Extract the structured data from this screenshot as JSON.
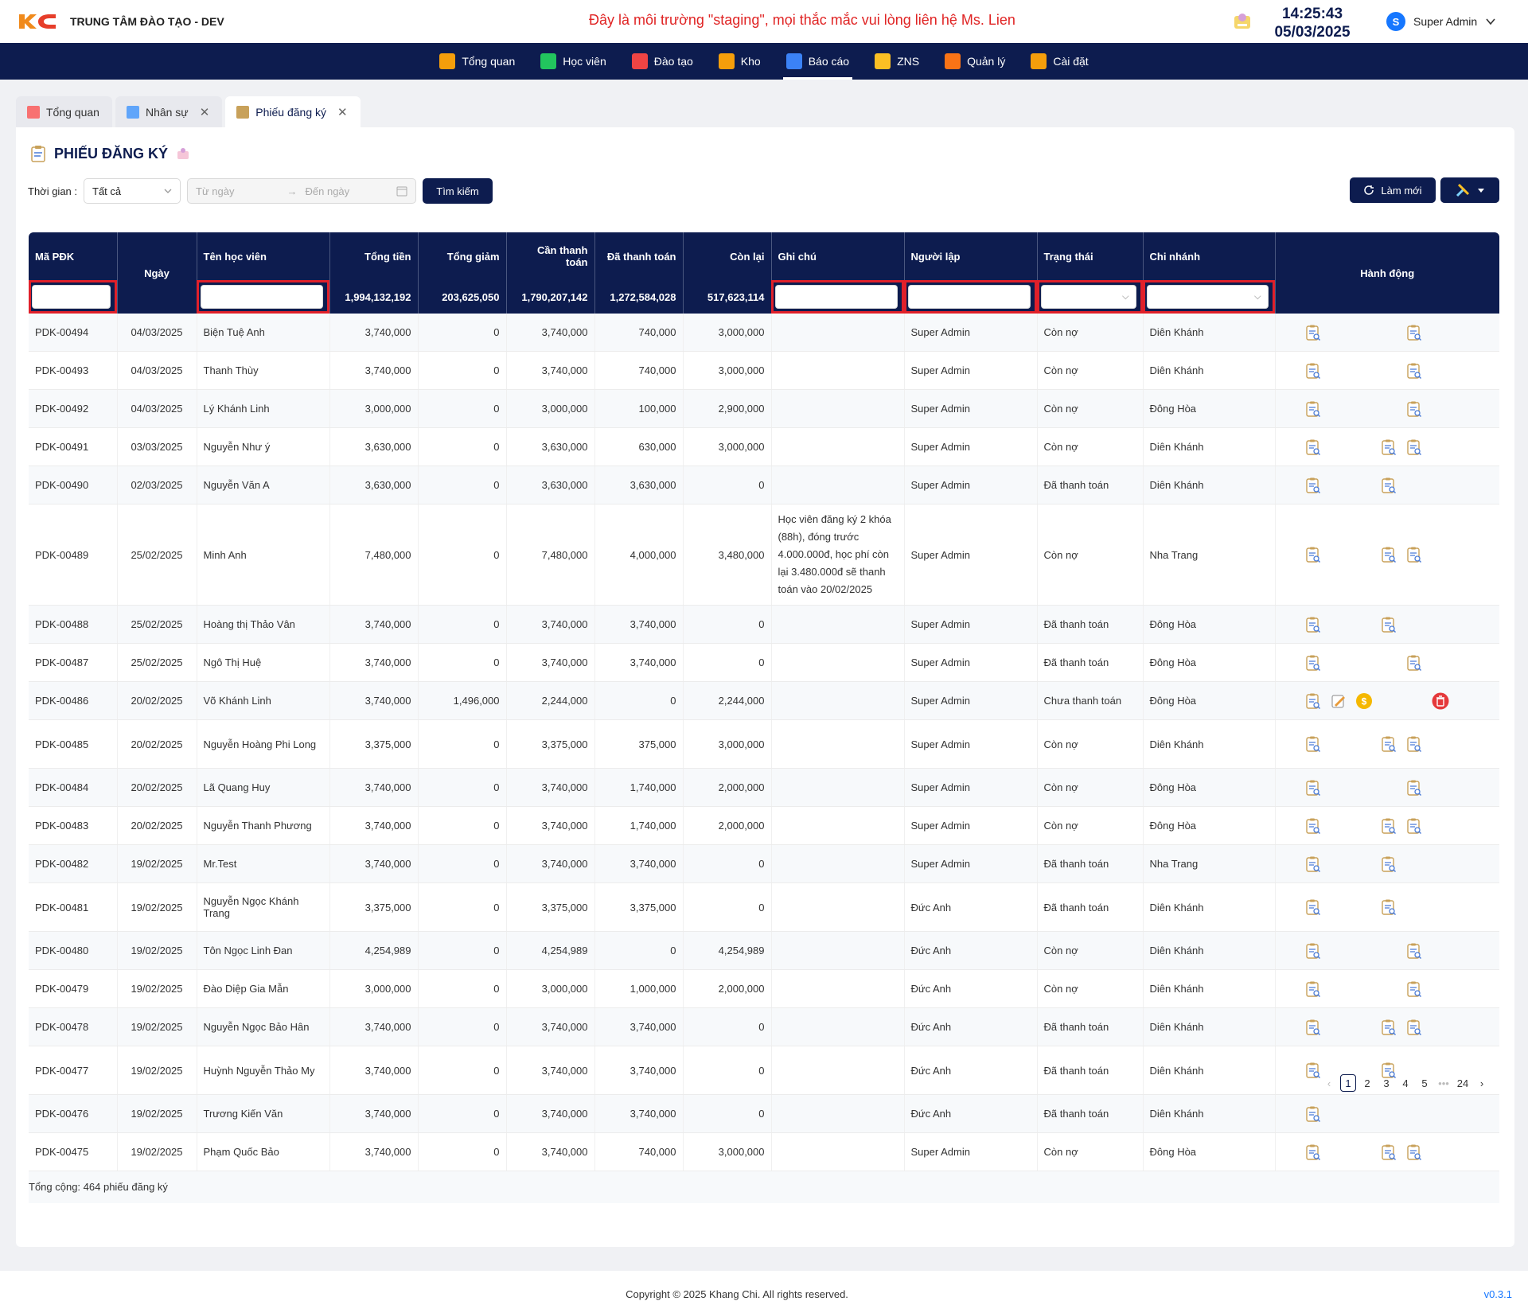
{
  "header": {
    "brand": "TRUNG TÂM ĐÀO TẠO - DEV",
    "marquee": "Đây là môi trường \"staging\", mọi thắc mắc vui lòng liên hệ Ms. Lien",
    "time": "14:25:43",
    "date": "05/03/2025",
    "avatar_letter": "S",
    "user": "Super Admin"
  },
  "nav": [
    {
      "label": "Tổng quan",
      "icon": "grid-icon",
      "color": "#f59e0b"
    },
    {
      "label": "Học viên",
      "icon": "graduation-cap-icon",
      "color": "#22c55e"
    },
    {
      "label": "Đào tạo",
      "icon": "pen-icon",
      "color": "#ef4444"
    },
    {
      "label": "Kho",
      "icon": "box-icon",
      "color": "#f59e0b"
    },
    {
      "label": "Báo cáo",
      "icon": "bar-chart-icon",
      "color": "#3b82f6",
      "active": true
    },
    {
      "label": "ZNS",
      "icon": "message-icon",
      "color": "#fbbf24"
    },
    {
      "label": "Quản lý",
      "icon": "manage-icon",
      "color": "#f97316"
    },
    {
      "label": "Cài đặt",
      "icon": "gear-icon",
      "color": "#f59e0b"
    }
  ],
  "tabs": [
    {
      "label": "Tổng quan",
      "closable": false
    },
    {
      "label": "Nhân sự",
      "closable": true
    },
    {
      "label": "Phiếu đăng ký",
      "closable": true,
      "active": true
    }
  ],
  "page": {
    "title": "PHIẾU ĐĂNG KÝ",
    "time_label": "Thời gian :",
    "time_value": "Tất cả",
    "from_placeholder": "Từ ngày",
    "to_placeholder": "Đến ngày",
    "search_btn": "Tìm kiếm",
    "refresh_btn": "Làm mới"
  },
  "table": {
    "columns": [
      "Mã PĐK",
      "Ngày",
      "Tên học viên",
      "Tổng tiền",
      "Tổng giảm",
      "Cần thanh toán",
      "Đã thanh toán",
      "Còn lại",
      "Ghi chú",
      "Người lập",
      "Trạng thái",
      "Chi nhánh",
      "Hành động"
    ],
    "totals": {
      "tong_tien": "1,994,132,192",
      "tong_giam": "203,625,050",
      "can_tt": "1,790,207,142",
      "da_tt": "1,272,584,028",
      "con_lai": "517,623,114"
    },
    "rows": [
      {
        "ma": "PDK-00494",
        "ngay": "04/03/2025",
        "ten": "Biện Tuệ Anh",
        "tong": "3,740,000",
        "giam": "0",
        "can": "3,740,000",
        "da": "740,000",
        "con": "3,000,000",
        "ghichu": "",
        "nguoi": "Super Admin",
        "tt": "Còn nợ",
        "cn": "Diên Khánh",
        "acts": [
          "view",
          "view@4"
        ]
      },
      {
        "ma": "PDK-00493",
        "ngay": "04/03/2025",
        "ten": "Thanh Thùy",
        "tong": "3,740,000",
        "giam": "0",
        "can": "3,740,000",
        "da": "740,000",
        "con": "3,000,000",
        "ghichu": "",
        "nguoi": "Super Admin",
        "tt": "Còn nợ",
        "cn": "Diên Khánh",
        "acts": [
          "view",
          "view@4"
        ]
      },
      {
        "ma": "PDK-00492",
        "ngay": "04/03/2025",
        "ten": "Lý Khánh Linh",
        "tong": "3,000,000",
        "giam": "0",
        "can": "3,000,000",
        "da": "100,000",
        "con": "2,900,000",
        "ghichu": "",
        "nguoi": "Super Admin",
        "tt": "Còn nợ",
        "cn": "Đông Hòa",
        "acts": [
          "view",
          "view@4"
        ]
      },
      {
        "ma": "PDK-00491",
        "ngay": "03/03/2025",
        "ten": "Nguyễn Như ý",
        "tong": "3,630,000",
        "giam": "0",
        "can": "3,630,000",
        "da": "630,000",
        "con": "3,000,000",
        "ghichu": "",
        "nguoi": "Super Admin",
        "tt": "Còn nợ",
        "cn": "Diên Khánh",
        "acts": [
          "view",
          "view@3",
          "view@4"
        ]
      },
      {
        "ma": "PDK-00490",
        "ngay": "02/03/2025",
        "ten": "Nguyễn Văn A",
        "tong": "3,630,000",
        "giam": "0",
        "can": "3,630,000",
        "da": "3,630,000",
        "con": "0",
        "ghichu": "",
        "nguoi": "Super Admin",
        "tt": "Đã thanh toán",
        "cn": "Diên Khánh",
        "acts": [
          "view",
          "view@3"
        ]
      },
      {
        "ma": "PDK-00489",
        "ngay": "25/02/2025",
        "ten": "Minh Anh",
        "tong": "7,480,000",
        "giam": "0",
        "can": "7,480,000",
        "da": "4,000,000",
        "con": "3,480,000",
        "ghichu": "Học viên đăng ký 2 khóa (88h), đóng trước 4.000.000đ, học phí còn lại 3.480.000đ sẽ thanh toán vào 20/02/2025",
        "nguoi": "Super Admin",
        "tt": "Còn nợ",
        "cn": "Nha Trang",
        "acts": [
          "view",
          "view@3",
          "view@4"
        ]
      },
      {
        "ma": "PDK-00488",
        "ngay": "25/02/2025",
        "ten": "Hoàng thị Thảo Vân",
        "tong": "3,740,000",
        "giam": "0",
        "can": "3,740,000",
        "da": "3,740,000",
        "con": "0",
        "ghichu": "",
        "nguoi": "Super Admin",
        "tt": "Đã thanh toán",
        "cn": "Đông Hòa",
        "acts": [
          "view",
          "view@3"
        ]
      },
      {
        "ma": "PDK-00487",
        "ngay": "25/02/2025",
        "ten": "Ngô Thị Huệ",
        "tong": "3,740,000",
        "giam": "0",
        "can": "3,740,000",
        "da": "3,740,000",
        "con": "0",
        "ghichu": "",
        "nguoi": "Super Admin",
        "tt": "Đã thanh toán",
        "cn": "Đông Hòa",
        "acts": [
          "view",
          "view@4"
        ]
      },
      {
        "ma": "PDK-00486",
        "ngay": "20/02/2025",
        "ten": "Võ Khánh Linh",
        "tong": "3,740,000",
        "giam": "1,496,000",
        "can": "2,244,000",
        "da": "0",
        "con": "2,244,000",
        "ghichu": "",
        "nguoi": "Super Admin",
        "tt": "Chưa thanh toán",
        "cn": "Đông Hòa",
        "acts": [
          "view",
          "edit",
          "pay",
          "delete"
        ]
      },
      {
        "ma": "PDK-00485",
        "ngay": "20/02/2025",
        "ten": "Nguyễn Hoàng Phi Long",
        "tong": "3,375,000",
        "giam": "0",
        "can": "3,375,000",
        "da": "375,000",
        "con": "3,000,000",
        "ghichu": "",
        "nguoi": "Super Admin",
        "tt": "Còn nợ",
        "cn": "Diên Khánh",
        "acts": [
          "view",
          "view@3",
          "view@4"
        ]
      },
      {
        "ma": "PDK-00484",
        "ngay": "20/02/2025",
        "ten": "Lã Quang Huy",
        "tong": "3,740,000",
        "giam": "0",
        "can": "3,740,000",
        "da": "1,740,000",
        "con": "2,000,000",
        "ghichu": "",
        "nguoi": "Super Admin",
        "tt": "Còn nợ",
        "cn": "Đông Hòa",
        "acts": [
          "view",
          "view@4"
        ]
      },
      {
        "ma": "PDK-00483",
        "ngay": "20/02/2025",
        "ten": "Nguyễn Thanh Phương",
        "tong": "3,740,000",
        "giam": "0",
        "can": "3,740,000",
        "da": "1,740,000",
        "con": "2,000,000",
        "ghichu": "",
        "nguoi": "Super Admin",
        "tt": "Còn nợ",
        "cn": "Đông Hòa",
        "acts": [
          "view",
          "view@3",
          "view@4"
        ]
      },
      {
        "ma": "PDK-00482",
        "ngay": "19/02/2025",
        "ten": "Mr.Test",
        "tong": "3,740,000",
        "giam": "0",
        "can": "3,740,000",
        "da": "3,740,000",
        "con": "0",
        "ghichu": "",
        "nguoi": "Super Admin",
        "tt": "Đã thanh toán",
        "cn": "Nha Trang",
        "acts": [
          "view",
          "view@3"
        ]
      },
      {
        "ma": "PDK-00481",
        "ngay": "19/02/2025",
        "ten": "Nguyễn Ngọc Khánh Trang",
        "tong": "3,375,000",
        "giam": "0",
        "can": "3,375,000",
        "da": "3,375,000",
        "con": "0",
        "ghichu": "",
        "nguoi": "Đức Anh",
        "tt": "Đã thanh toán",
        "cn": "Diên Khánh",
        "acts": [
          "view",
          "view@3"
        ]
      },
      {
        "ma": "PDK-00480",
        "ngay": "19/02/2025",
        "ten": "Tôn Ngọc Linh Đan",
        "tong": "4,254,989",
        "giam": "0",
        "can": "4,254,989",
        "da": "0",
        "con": "4,254,989",
        "ghichu": "",
        "nguoi": "Đức Anh",
        "tt": "Còn nợ",
        "cn": "Diên Khánh",
        "acts": [
          "view",
          "view@4"
        ]
      },
      {
        "ma": "PDK-00479",
        "ngay": "19/02/2025",
        "ten": "Đào Diệp Gia Mẫn",
        "tong": "3,000,000",
        "giam": "0",
        "can": "3,000,000",
        "da": "1,000,000",
        "con": "2,000,000",
        "ghichu": "",
        "nguoi": "Đức Anh",
        "tt": "Còn nợ",
        "cn": "Diên Khánh",
        "acts": [
          "view",
          "view@4"
        ]
      },
      {
        "ma": "PDK-00478",
        "ngay": "19/02/2025",
        "ten": "Nguyễn Ngọc Bảo Hân",
        "tong": "3,740,000",
        "giam": "0",
        "can": "3,740,000",
        "da": "3,740,000",
        "con": "0",
        "ghichu": "",
        "nguoi": "Đức Anh",
        "tt": "Đã thanh toán",
        "cn": "Diên Khánh",
        "acts": [
          "view",
          "view@3",
          "view@4"
        ]
      },
      {
        "ma": "PDK-00477",
        "ngay": "19/02/2025",
        "ten": "Huỳnh Nguyễn Thảo My",
        "tong": "3,740,000",
        "giam": "0",
        "can": "3,740,000",
        "da": "3,740,000",
        "con": "0",
        "ghichu": "",
        "nguoi": "Đức Anh",
        "tt": "Đã thanh toán",
        "cn": "Diên Khánh",
        "acts": [
          "view",
          "view@3"
        ]
      },
      {
        "ma": "PDK-00476",
        "ngay": "19/02/2025",
        "ten": "Trương Kiến Văn",
        "tong": "3,740,000",
        "giam": "0",
        "can": "3,740,000",
        "da": "3,740,000",
        "con": "0",
        "ghichu": "",
        "nguoi": "Đức Anh",
        "tt": "Đã thanh toán",
        "cn": "Diên Khánh",
        "acts": [
          "view"
        ]
      },
      {
        "ma": "PDK-00475",
        "ngay": "19/02/2025",
        "ten": "Phạm Quốc Bảo",
        "tong": "3,740,000",
        "giam": "0",
        "can": "3,740,000",
        "da": "740,000",
        "con": "3,000,000",
        "ghichu": "",
        "nguoi": "Super Admin",
        "tt": "Còn nợ",
        "cn": "Đông Hòa",
        "acts": [
          "view",
          "view@3",
          "view@4"
        ]
      }
    ],
    "summary": "Tổng cộng: 464 phiếu đăng ký"
  },
  "pagination": {
    "pages": [
      "1",
      "2",
      "3",
      "4",
      "5",
      "•••",
      "24"
    ],
    "current": "1"
  },
  "footer": {
    "copyright": "Copyright © 2025 Khang Chi. All rights reserved.",
    "version": "v0.3.1"
  }
}
